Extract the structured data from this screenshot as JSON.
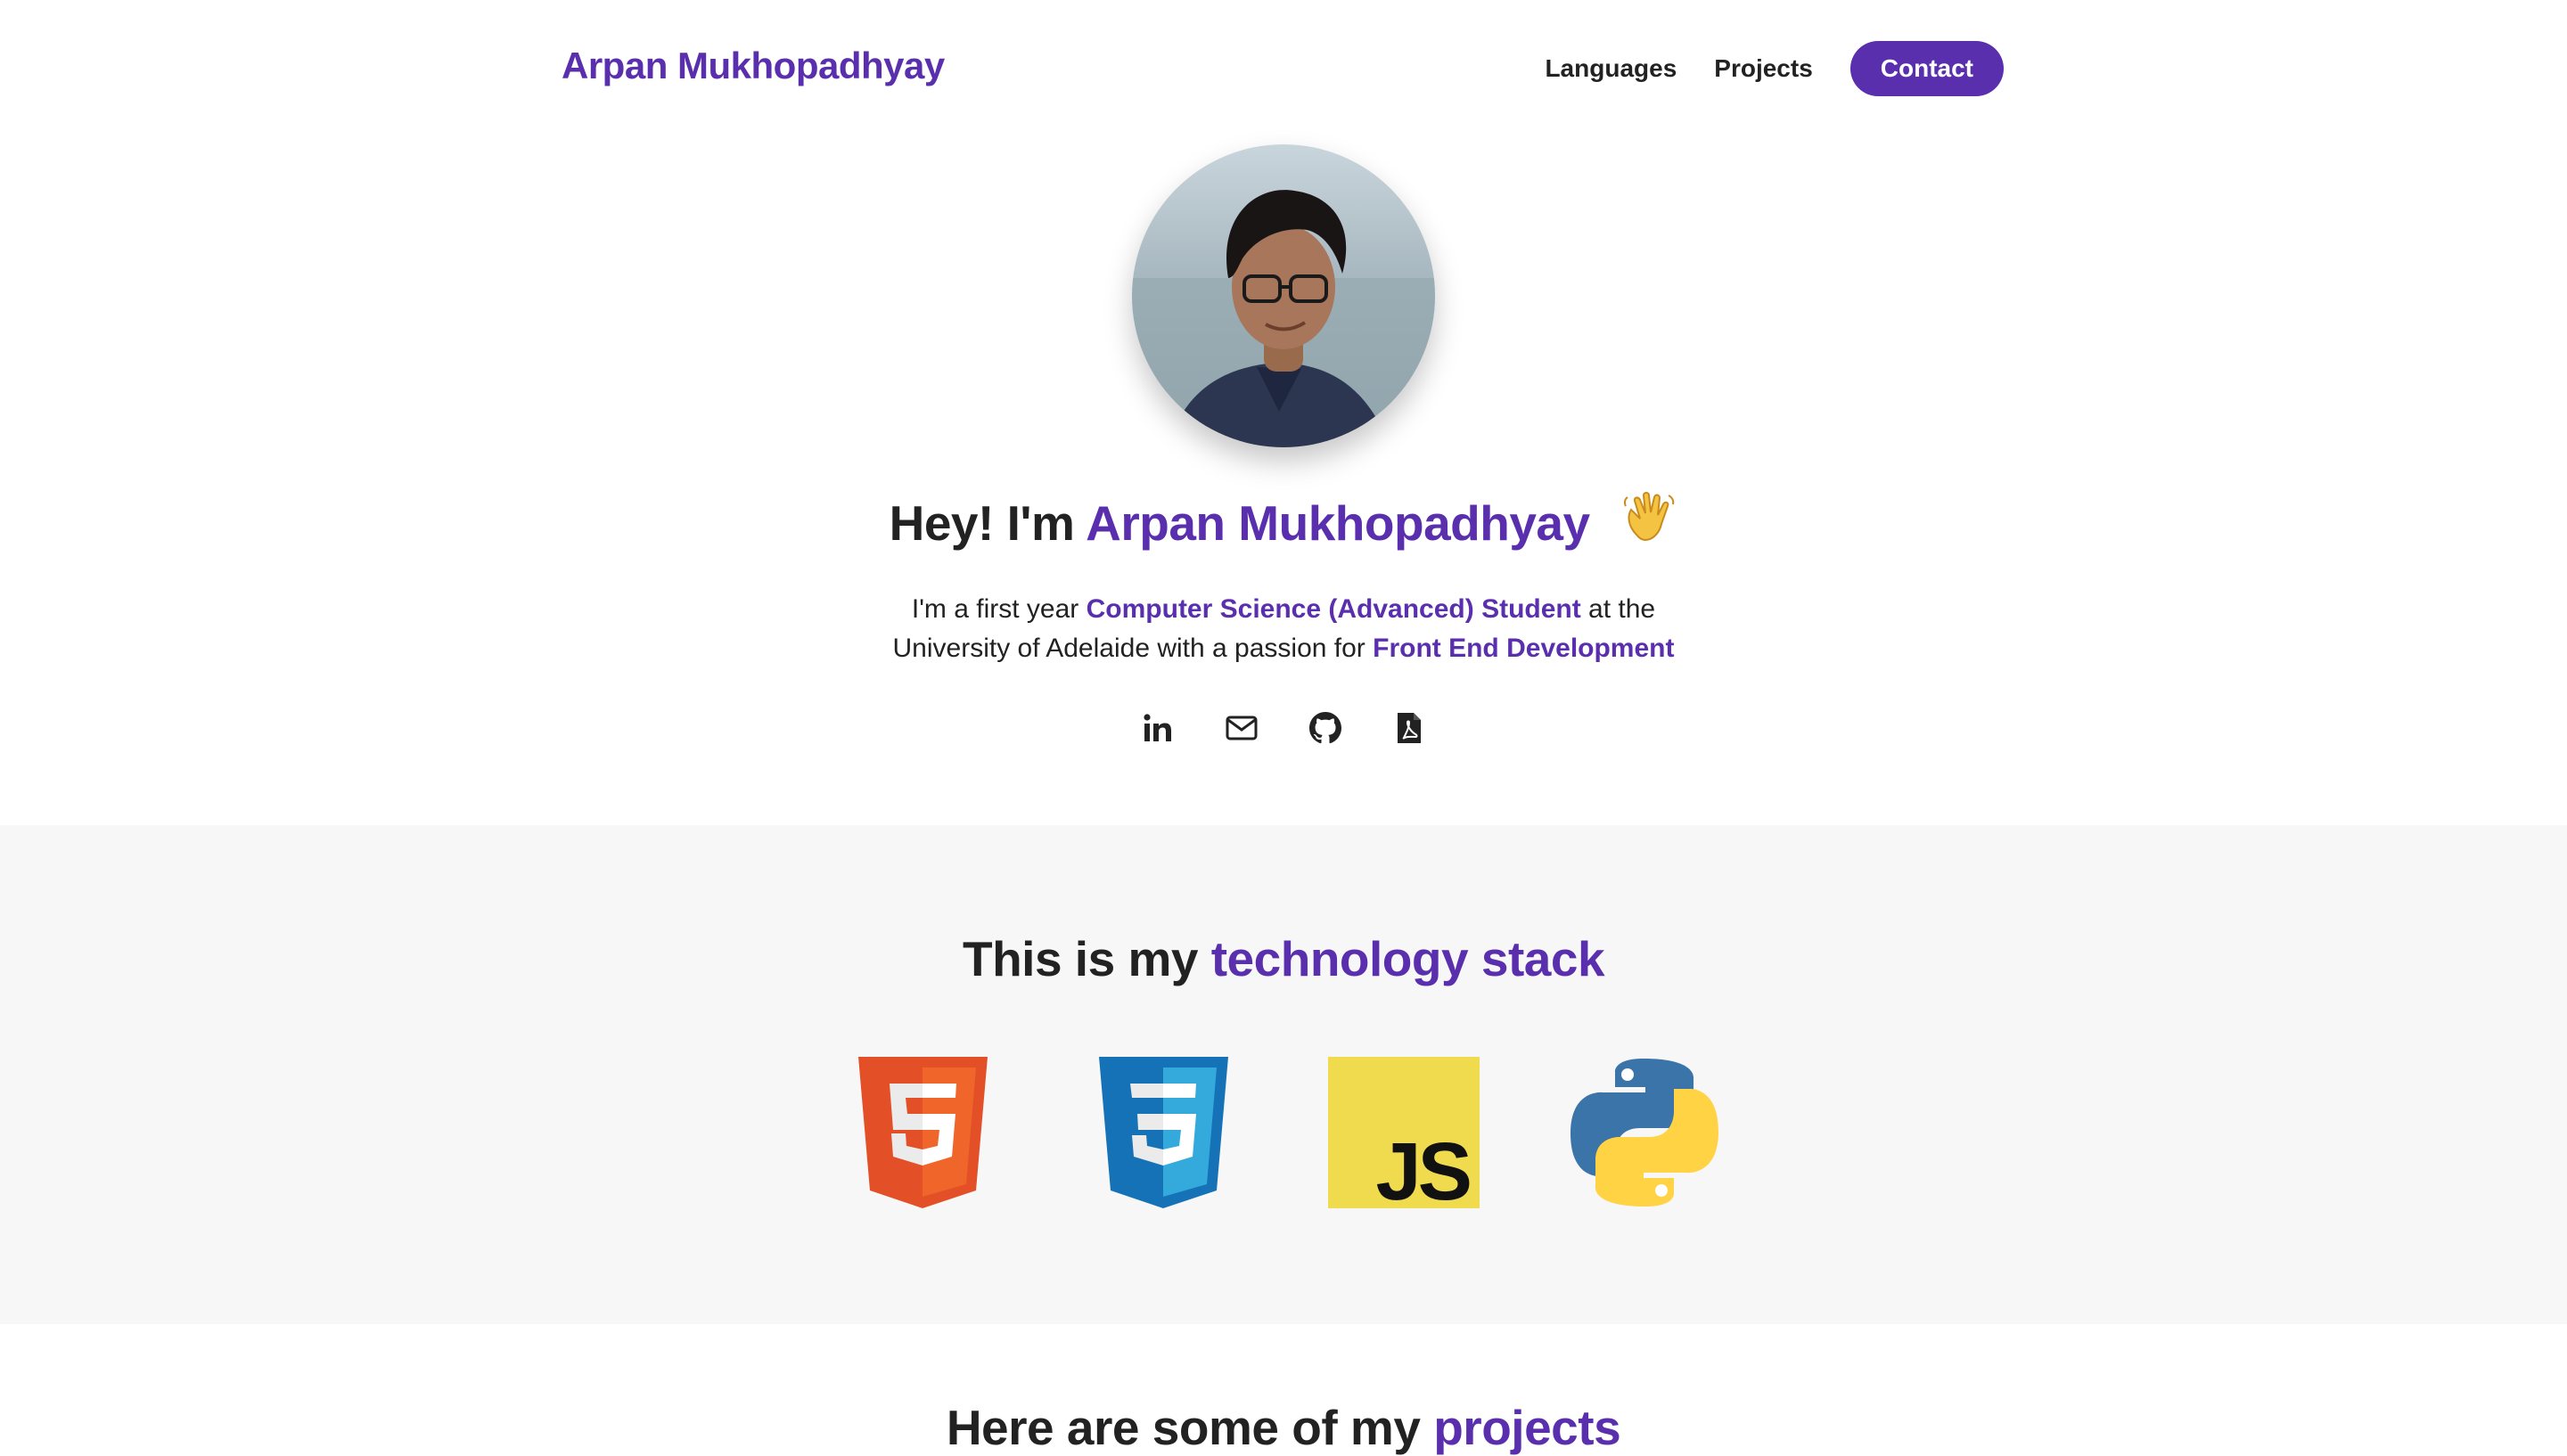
{
  "header": {
    "brand": "Arpan Mukhopadhyay",
    "nav": {
      "languages": "Languages",
      "projects": "Projects",
      "contact": "Contact"
    }
  },
  "hero": {
    "greeting_prefix": "Hey! I'm ",
    "name": "Arpan Mukhopadhyay",
    "desc_1": "I'm a first year ",
    "desc_highlight_1": "Computer Science (Advanced) Student",
    "desc_2": " at the",
    "desc_3": "University of Adelaide with a passion for ",
    "desc_highlight_2": "Front End Development",
    "socials": [
      "linkedin-icon",
      "mail-icon",
      "github-icon",
      "pdf-icon"
    ]
  },
  "stray_text": "=",
  "tech": {
    "title_prefix": "This is my ",
    "title_highlight": "technology stack",
    "logos": [
      "html5-logo",
      "css3-logo",
      "javascript-logo",
      "python-logo"
    ],
    "js_text": "JS"
  },
  "projects": {
    "title_prefix": "Here are some of my ",
    "title_highlight": "projects"
  },
  "colors": {
    "accent": "#5a2fae",
    "text": "#222222",
    "section_bg": "#f7f7f7"
  }
}
